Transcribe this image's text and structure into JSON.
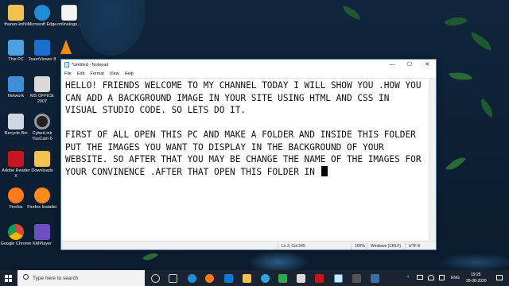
{
  "desktop": {
    "icons": [
      {
        "label": "thanos kohli",
        "icon": "folder-icon"
      },
      {
        "label": "Microsoft Edge",
        "icon": "edge-icon"
      },
      {
        "label": "onlinelogo...",
        "icon": "image-file-icon"
      },
      {
        "label": "This PC",
        "icon": "computer-icon"
      },
      {
        "label": "TeamViewer 8",
        "icon": "teamviewer-icon"
      },
      {
        "label": "Network",
        "icon": "network-icon"
      },
      {
        "label": "MS OFFICE 2007",
        "icon": "office-icon"
      },
      {
        "label": "Recycle Bin",
        "icon": "recycle-bin-icon"
      },
      {
        "label": "CyberLink YouCam 6",
        "icon": "youcam-icon"
      },
      {
        "label": "Adobe Reader X",
        "icon": "adobe-reader-icon"
      },
      {
        "label": "Downloads",
        "icon": "downloads-icon"
      },
      {
        "label": "Firefox",
        "icon": "firefox-icon"
      },
      {
        "label": "Firefox Installer",
        "icon": "firefox-installer-icon"
      },
      {
        "label": "Google Chrome",
        "icon": "chrome-icon"
      },
      {
        "label": "KMPlayer",
        "icon": "kmplayer-icon"
      }
    ]
  },
  "notepad": {
    "title": "*Untitled - Notepad",
    "menu": [
      "File",
      "Edit",
      "Format",
      "View",
      "Help"
    ],
    "window_controls": {
      "minimize": "—",
      "maximize": "☐",
      "close": "✕"
    },
    "content": "HELLO! FRIENDS WELCOME TO MY CHANNEL TODAY I WILL SHOW YOU .HOW YOU CAN ADD A BACKGROUND IMAGE IN YOUR SITE USING HTML AND CSS IN VISUAL STUDIO CODE. SO LETS DO IT.\n\nFIRST OF ALL OPEN THIS PC AND MAKE A FOLDER AND INSIDE THIS FOLDER PUT THE IMAGES YOU WANT TO DISPLAY IN THE BACKGROUND OF YOUR WEBSITE. SO AFTER THAT YOU MAY BE CHANGE THE NAME OF THE IMAGES FOR YOUR CONVINENCE .AFTER THAT OPEN THIS FOLDER IN ",
    "status": {
      "position": "Ln 3, Col 245",
      "zoom": "100%",
      "line_ending": "Windows (CRLF)",
      "encoding": "UTF-8"
    }
  },
  "taskbar": {
    "search_placeholder": "Type here to search",
    "tray": {
      "language": "ENG",
      "time": "19:25",
      "date": "28-08-2020"
    }
  },
  "colors": {
    "accent": "#0078d7",
    "taskbar_bg": "#1a2330",
    "wallpaper": "#0e2238"
  }
}
